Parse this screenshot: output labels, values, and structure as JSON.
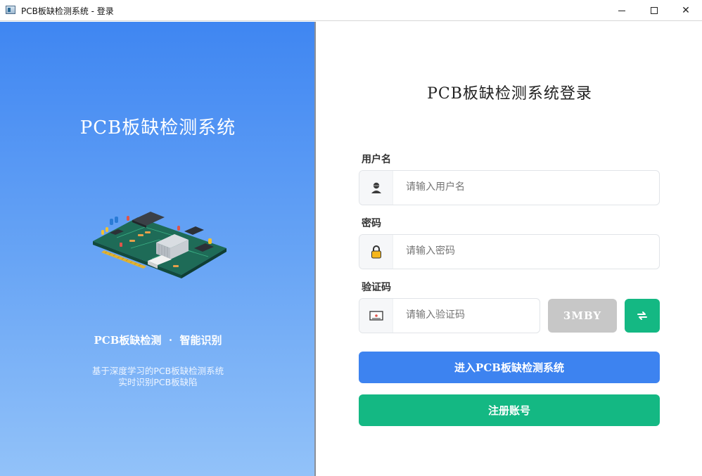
{
  "window": {
    "title": "PCB板缺检测系统 - 登录",
    "minimize_glyph": "",
    "maximize_glyph": "",
    "close_glyph": "✕"
  },
  "left": {
    "title": "PCB板缺检测系统",
    "tagline": "PCB板缺检测  ·  智能识别",
    "desc_line1": "基于深度学习的PCB板缺检测系统",
    "desc_line2": "实时识别PCB板缺陷",
    "illustration_icon": "pcb-board-illustration"
  },
  "login": {
    "title": "PCB板缺检测系统登录",
    "username": {
      "label": "用户名",
      "placeholder": "请输入用户名",
      "icon": "user-icon"
    },
    "password": {
      "label": "密码",
      "placeholder": "请输入密码",
      "icon": "lock-icon"
    },
    "captcha": {
      "label": "验证码",
      "placeholder": "请输入验证码",
      "icon": "captcha-icon",
      "code": "3MBY",
      "refresh_icon": "refresh-icon"
    },
    "submit_label": "进入PCB板缺检测系统",
    "register_label": "注册账号"
  },
  "colors": {
    "gradient_top": "#3f86f2",
    "gradient_bottom": "#92c2f9",
    "primary": "#3d83f0",
    "success": "#14b883",
    "captcha_bg": "#c7c7c7"
  }
}
